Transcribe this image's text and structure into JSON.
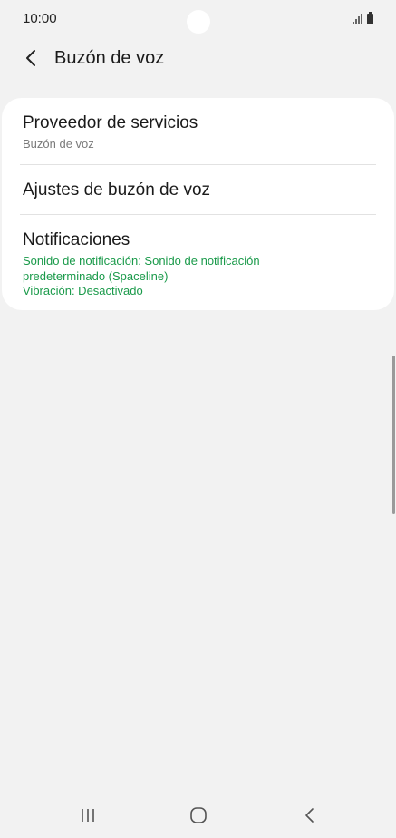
{
  "status_bar": {
    "time": "10:00",
    "icons": [
      "signal-icon",
      "battery-icon"
    ]
  },
  "app_bar": {
    "back_icon": "chevron-left-icon",
    "title": "Buzón de voz"
  },
  "settings": {
    "items": [
      {
        "title": "Proveedor de servicios",
        "subtitle": "Buzón de voz"
      },
      {
        "title": "Ajustes de buzón de voz"
      },
      {
        "title": "Notificaciones",
        "subtitle_line1": "Sonido de notificación: Sonido de notificación predeterminado (Spaceline)",
        "subtitle_line2": "Vibración: Desactivado"
      }
    ]
  },
  "colors": {
    "background": "#f2f2f2",
    "card": "#ffffff",
    "accent_green": "#1a9a4a"
  },
  "nav_bar": {
    "icons": [
      "recent-apps-icon",
      "home-icon",
      "back-icon"
    ]
  }
}
